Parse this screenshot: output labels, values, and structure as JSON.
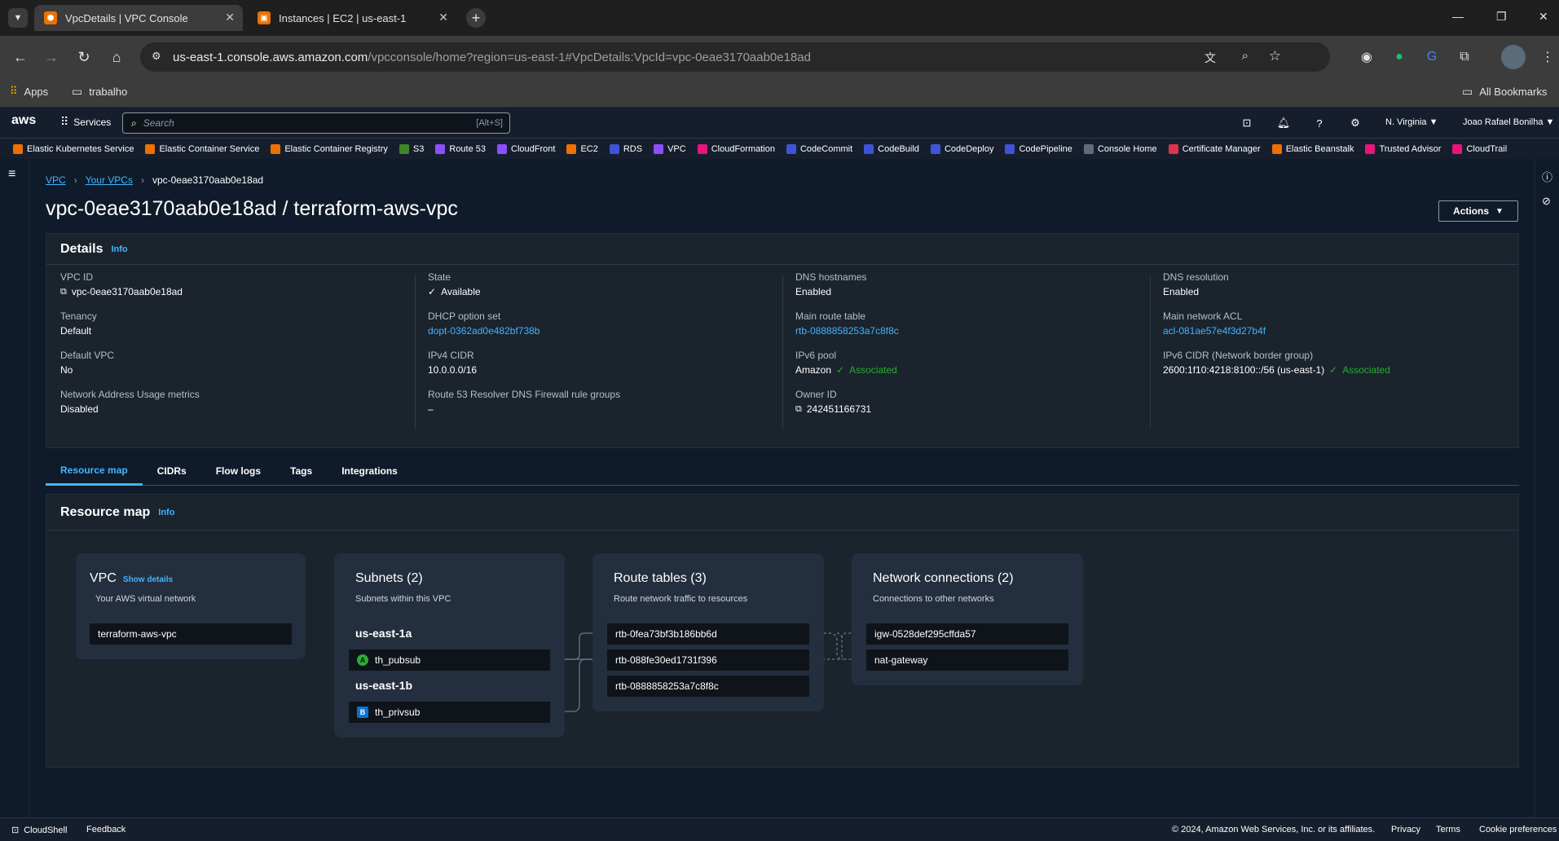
{
  "browser": {
    "tabs": [
      {
        "label": "VpcDetails | VPC Console",
        "active": true
      },
      {
        "label": "Instances | EC2 | us-east-1",
        "active": false
      }
    ],
    "url_host": "us-east-1.console.aws.amazon.com",
    "url_path": "/vpcconsole/home?region=us-east-1#VpcDetails:VpcId=vpc-0eae3170aab0e18ad",
    "bookmarks": {
      "apps": "Apps",
      "folder": "trabalho",
      "all": "All Bookmarks"
    }
  },
  "aws": {
    "logo": "aws",
    "services": "Services",
    "search_placeholder": "Search",
    "search_shortcut": "[Alt+S]",
    "region": "N. Virginia",
    "user": "Joao Rafael Bonilha",
    "favorites": [
      {
        "label": "Elastic Kubernetes Service",
        "color": "#ed7100"
      },
      {
        "label": "Elastic Container Service",
        "color": "#ed7100"
      },
      {
        "label": "Elastic Container Registry",
        "color": "#ed7100"
      },
      {
        "label": "S3",
        "color": "#3f8624"
      },
      {
        "label": "Route 53",
        "color": "#8c4fff"
      },
      {
        "label": "CloudFront",
        "color": "#8c4fff"
      },
      {
        "label": "EC2",
        "color": "#ed7100"
      },
      {
        "label": "RDS",
        "color": "#4053d6"
      },
      {
        "label": "VPC",
        "color": "#8c4fff"
      },
      {
        "label": "CloudFormation",
        "color": "#e7157b"
      },
      {
        "label": "CodeCommit",
        "color": "#4053d6"
      },
      {
        "label": "CodeBuild",
        "color": "#4053d6"
      },
      {
        "label": "CodeDeploy",
        "color": "#4053d6"
      },
      {
        "label": "CodePipeline",
        "color": "#4053d6"
      },
      {
        "label": "Console Home",
        "color": "#5f6b7a"
      },
      {
        "label": "Certificate Manager",
        "color": "#dd344c"
      },
      {
        "label": "Elastic Beanstalk",
        "color": "#ed7100"
      },
      {
        "label": "Trusted Advisor",
        "color": "#e7157b"
      },
      {
        "label": "CloudTrail",
        "color": "#e7157b"
      }
    ]
  },
  "breadcrumb": {
    "root": "VPC",
    "parent": "Your VPCs",
    "current": "vpc-0eae3170aab0e18ad"
  },
  "page": {
    "title": "vpc-0eae3170aab0e18ad / terraform-aws-vpc",
    "actions": "Actions"
  },
  "details": {
    "heading": "Details",
    "info": "Info",
    "vpc_id_label": "VPC ID",
    "vpc_id": "vpc-0eae3170aab0e18ad",
    "tenancy_label": "Tenancy",
    "tenancy": "Default",
    "default_vpc_label": "Default VPC",
    "default_vpc": "No",
    "nau_label": "Network Address Usage metrics",
    "nau": "Disabled",
    "state_label": "State",
    "state": "Available",
    "dhcp_label": "DHCP option set",
    "dhcp": "dopt-0362ad0e482bf738b",
    "ipv4_label": "IPv4 CIDR",
    "ipv4": "10.0.0.0/16",
    "r53_label": "Route 53 Resolver DNS Firewall rule groups",
    "r53": "–",
    "dns_host_label": "DNS hostnames",
    "dns_host": "Enabled",
    "main_rt_label": "Main route table",
    "main_rt": "rtb-0888858253a7c8f8c",
    "ipv6_pool_label": "IPv6 pool",
    "ipv6_pool": "Amazon",
    "ipv6_pool_status": "Associated",
    "owner_label": "Owner ID",
    "owner": "242451166731",
    "dns_res_label": "DNS resolution",
    "dns_res": "Enabled",
    "acl_label": "Main network ACL",
    "acl": "acl-081ae57e4f3d27b4f",
    "ipv6_cidr_label": "IPv6 CIDR (Network border group)",
    "ipv6_cidr": "2600:1f10:4218:8100::/56 (us-east-1)",
    "ipv6_cidr_status": "Associated"
  },
  "tabs": [
    "Resource map",
    "CIDRs",
    "Flow logs",
    "Tags",
    "Integrations"
  ],
  "resource_map": {
    "heading": "Resource map",
    "info": "Info",
    "vpc": {
      "title": "VPC",
      "link": "Show details",
      "subtitle": "Your AWS virtual network",
      "name": "terraform-aws-vpc"
    },
    "subnets": {
      "title": "Subnets (2)",
      "subtitle": "Subnets within this VPC",
      "az1": "us-east-1a",
      "subnet1": "th_pubsub",
      "az2": "us-east-1b",
      "subnet2": "th_privsub"
    },
    "route_tables": {
      "title": "Route tables (3)",
      "subtitle": "Route network traffic to resources",
      "items": [
        "rtb-0fea73bf3b186bb6d",
        "rtb-088fe30ed1731f396",
        "rtb-0888858253a7c8f8c"
      ]
    },
    "connections": {
      "title": "Network connections (2)",
      "subtitle": "Connections to other networks",
      "items": [
        "igw-0528def295cffda57",
        "nat-gateway"
      ]
    }
  },
  "footer": {
    "cloudshell": "CloudShell",
    "feedback": "Feedback",
    "copyright": "© 2024, Amazon Web Services, Inc. or its affiliates.",
    "privacy": "Privacy",
    "terms": "Terms",
    "cookies": "Cookie preferences"
  }
}
